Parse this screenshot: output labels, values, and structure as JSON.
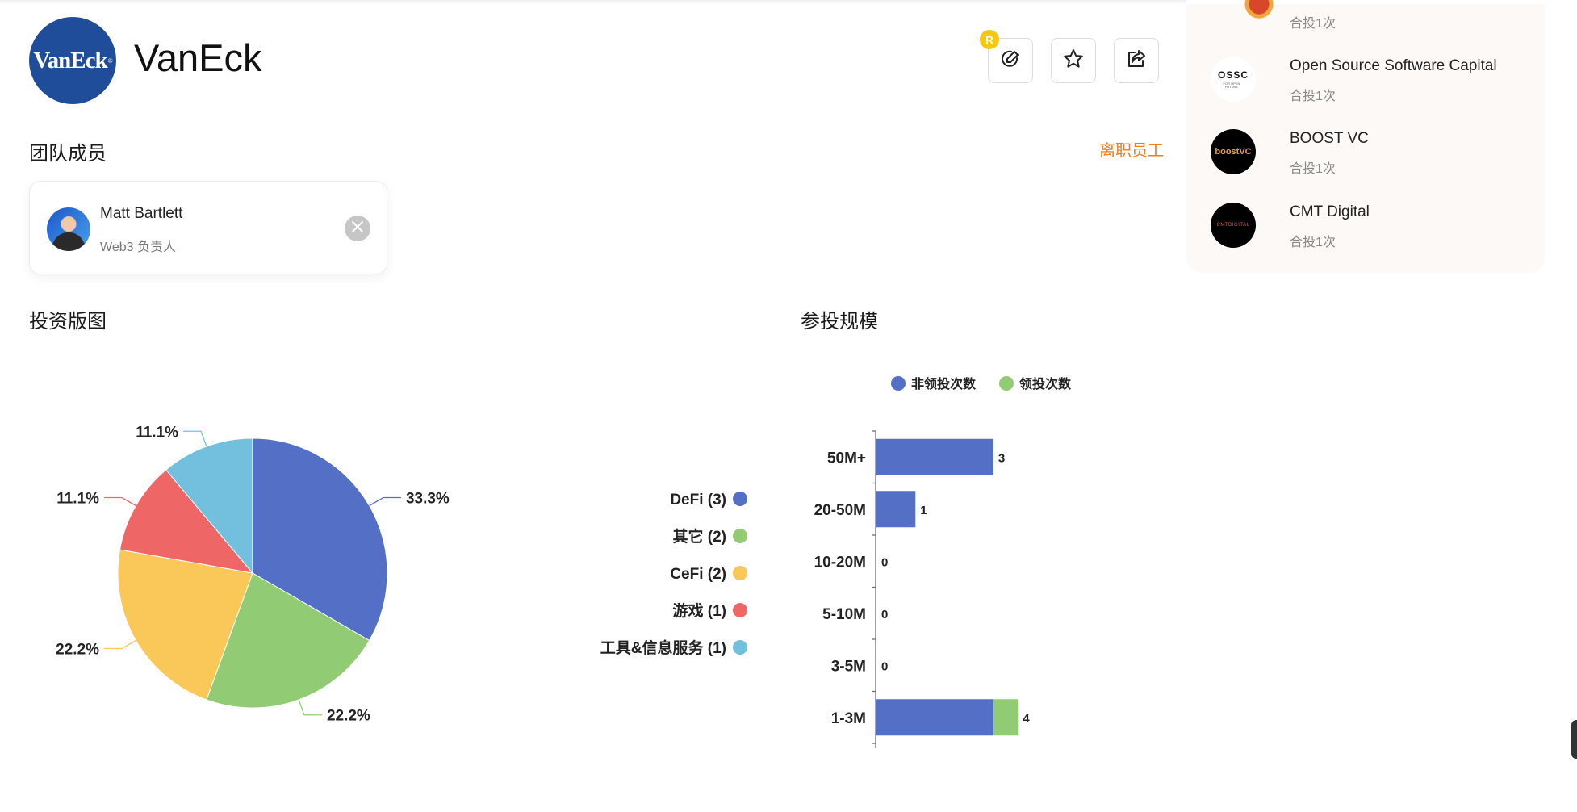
{
  "header": {
    "logo_text": "VanEck",
    "org_name": "VanEck",
    "badge": "R",
    "colors": {
      "logo_bg": "#1f4d9a",
      "badge": "#f6c80f"
    }
  },
  "team": {
    "title": "团队成员",
    "former_link": "离职员工",
    "members": [
      {
        "name": "Matt Bartlett",
        "role": "Web3 负责人"
      }
    ]
  },
  "co_investors": [
    {
      "name": "",
      "count": "合投1次"
    },
    {
      "name": "Open Source Software Capital",
      "count": "合投1次",
      "logo_text": "OSSC",
      "logo_sub": "FOR OPEN FUTURE"
    },
    {
      "name": "BOOST VC",
      "count": "合投1次",
      "logo_text": "boostVC"
    },
    {
      "name": "CMT Digital",
      "count": "合投1次",
      "logo_text": "CMTDIGITAL"
    }
  ],
  "portfolio": {
    "title": "投资版图",
    "chart_data": {
      "type": "pie",
      "slices": [
        {
          "name": "DeFi (3)",
          "value": 3,
          "percent": "33.3%",
          "color": "#5470c6"
        },
        {
          "name": "其它 (2)",
          "value": 2,
          "percent": "22.2%",
          "color": "#91cc75"
        },
        {
          "name": "CeFi (2)",
          "value": 2,
          "percent": "22.2%",
          "color": "#fac858"
        },
        {
          "name": "游戏 (1)",
          "value": 1,
          "percent": "11.1%",
          "color": "#ee6666"
        },
        {
          "name": "工具&信息服务 (1)",
          "value": 1,
          "percent": "11.1%",
          "color": "#73c0de"
        }
      ],
      "legend_position": "right"
    }
  },
  "scale": {
    "title": "参投规模",
    "chart_data": {
      "type": "bar",
      "orientation": "horizontal",
      "stacked": true,
      "categories": [
        "50M+",
        "20-50M",
        "10-20M",
        "5-10M",
        "3-5M",
        "1-3M"
      ],
      "series": [
        {
          "name": "非领投次数",
          "values": [
            3,
            1,
            0,
            0,
            0,
            3
          ],
          "color": "#5470c6"
        },
        {
          "name": "领投次数",
          "values": [
            0,
            0,
            0,
            0,
            0,
            1
          ],
          "color": "#91cc75"
        }
      ],
      "totals": [
        "3",
        "1",
        "0",
        "0",
        "0",
        "4"
      ],
      "xlim": [
        0,
        4
      ],
      "legend_position": "top"
    }
  }
}
